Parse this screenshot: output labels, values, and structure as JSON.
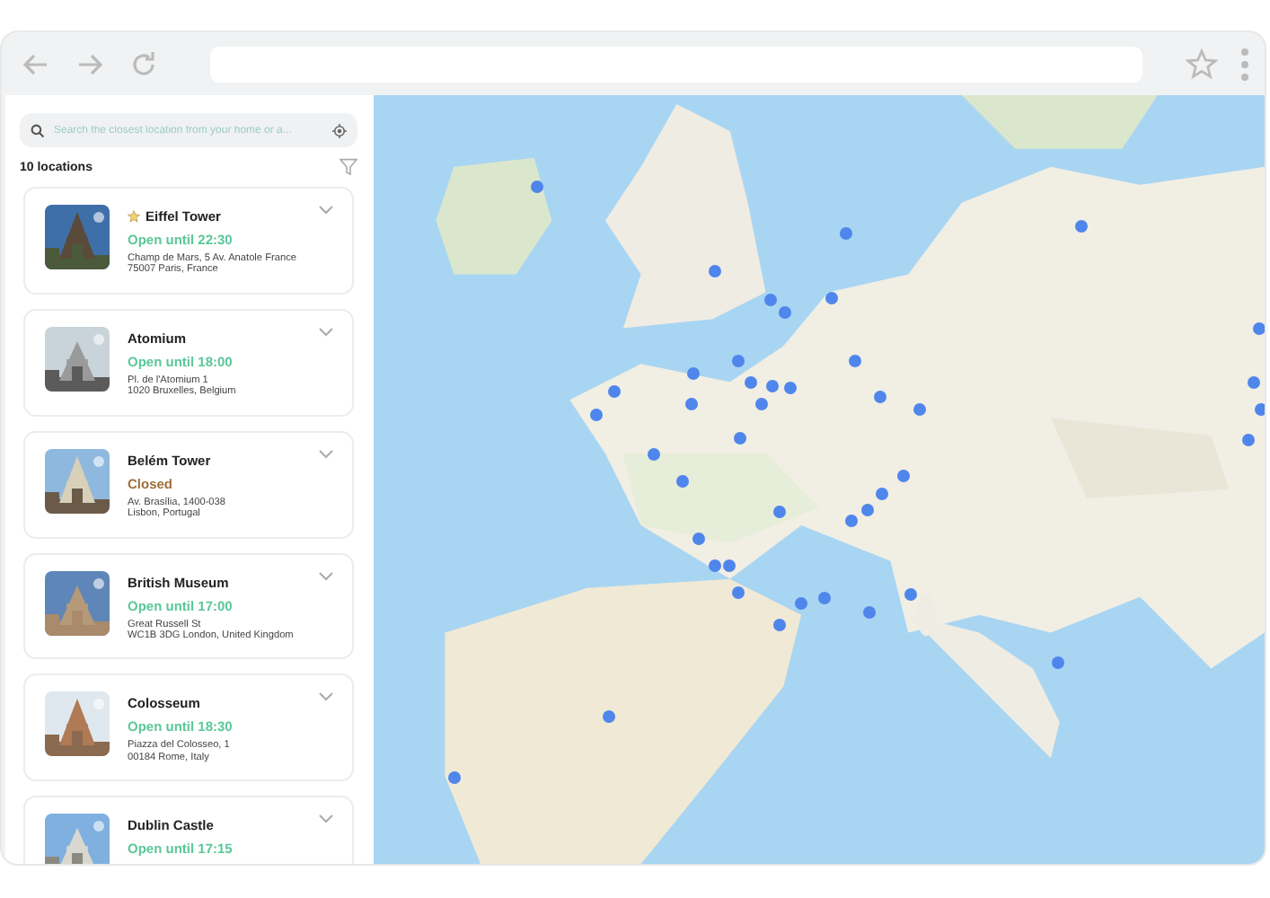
{
  "sidebar": {
    "search": {
      "placeholder": "Search the closest location from your home or a..."
    },
    "count": "10 locations",
    "locations": [
      {
        "name": "Eiffel Tower",
        "favorite": true,
        "open": true,
        "status": "Open until 22:30",
        "address": [
          "Champ de Mars, 5 Av. Anatole France",
          "75007 Paris, France"
        ]
      },
      {
        "name": "Atomium",
        "favorite": false,
        "open": true,
        "status": "Open until 18:00",
        "address": [
          "Pl. de l'Atomium 1",
          "1020 Bruxelles, Belgium"
        ]
      },
      {
        "name": "Belém Tower",
        "favorite": false,
        "open": false,
        "status": "Closed",
        "address": [
          "Av. Brasília, 1400-038",
          "Lisbon, Portugal"
        ]
      },
      {
        "name": "British Museum",
        "favorite": false,
        "open": true,
        "status": "Open until 17:00",
        "address": [
          "Great Russell St",
          "WC1B 3DG London, United Kingdom"
        ]
      },
      {
        "name": "Colosseum",
        "favorite": false,
        "open": true,
        "status": "Open until 18:30",
        "address": [
          "Piazza del Colosseo, 1",
          "00184 Rome, Italy"
        ]
      },
      {
        "name": "Dublin Castle",
        "favorite": false,
        "open": true,
        "status": "Open until 17:15"
      }
    ]
  }
}
